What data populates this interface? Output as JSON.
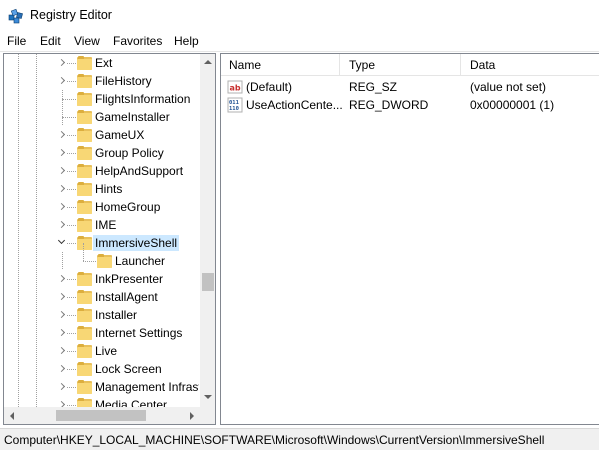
{
  "window": {
    "title": "Registry Editor",
    "icon": "registry-editor-icon"
  },
  "menu": [
    "File",
    "Edit",
    "View",
    "Favorites",
    "Help"
  ],
  "tree": {
    "items": [
      {
        "label": "Ext",
        "expander": "collapsed"
      },
      {
        "label": "FileHistory",
        "expander": "collapsed"
      },
      {
        "label": "FlightsInformation",
        "expander": "none"
      },
      {
        "label": "GameInstaller",
        "expander": "none"
      },
      {
        "label": "GameUX",
        "expander": "collapsed"
      },
      {
        "label": "Group Policy",
        "expander": "collapsed"
      },
      {
        "label": "HelpAndSupport",
        "expander": "collapsed"
      },
      {
        "label": "Hints",
        "expander": "collapsed"
      },
      {
        "label": "HomeGroup",
        "expander": "collapsed"
      },
      {
        "label": "IME",
        "expander": "collapsed"
      },
      {
        "label": "ImmersiveShell",
        "expander": "expanded",
        "selected": true
      },
      {
        "label": "Launcher",
        "expander": "none",
        "child": true
      },
      {
        "label": "InkPresenter",
        "expander": "collapsed"
      },
      {
        "label": "InstallAgent",
        "expander": "collapsed"
      },
      {
        "label": "Installer",
        "expander": "collapsed"
      },
      {
        "label": "Internet Settings",
        "expander": "collapsed"
      },
      {
        "label": "Live",
        "expander": "collapsed"
      },
      {
        "label": "Lock Screen",
        "expander": "collapsed"
      },
      {
        "label": "Management Infrast",
        "expander": "collapsed"
      },
      {
        "label": "Media Center",
        "expander": "collapsed"
      }
    ]
  },
  "list": {
    "columns": [
      "Name",
      "Type",
      "Data"
    ],
    "rows": [
      {
        "icon": "string-value-icon",
        "name": "(Default)",
        "type": "REG_SZ",
        "data": "(value not set)"
      },
      {
        "icon": "binary-value-icon",
        "name": "UseActionCente...",
        "type": "REG_DWORD",
        "data": "0x00000001 (1)"
      }
    ]
  },
  "status": {
    "path": "Computer\\HKEY_LOCAL_MACHINE\\SOFTWARE\\Microsoft\\Windows\\CurrentVersion\\ImmersiveShell"
  },
  "colors": {
    "selection": "#cce8ff",
    "folder": "#f8d775",
    "border": "#828790"
  }
}
